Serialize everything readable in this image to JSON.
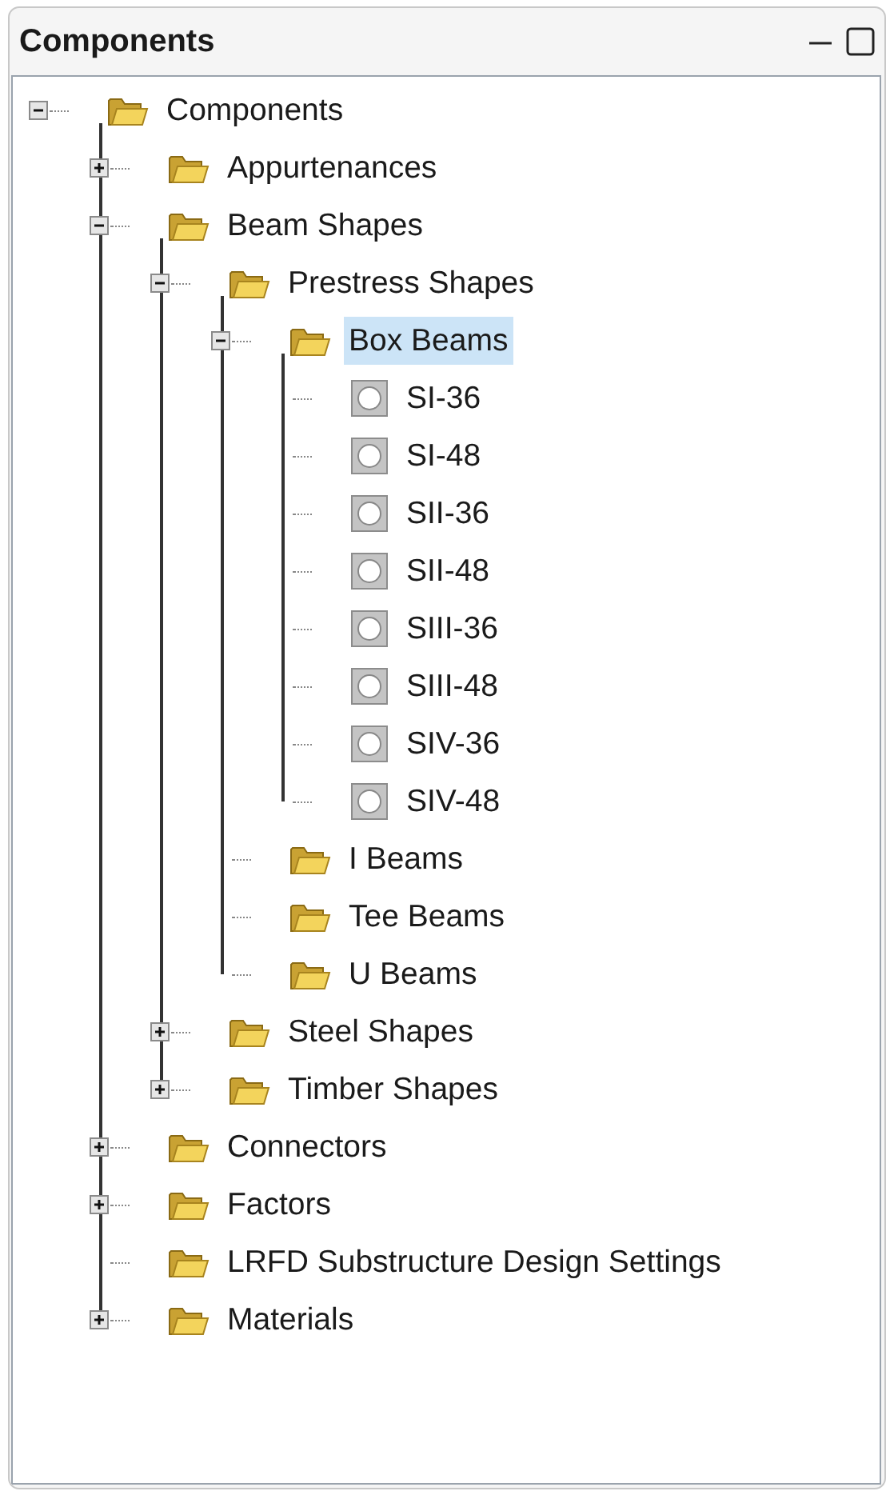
{
  "panel": {
    "title": "Components"
  },
  "tree": [
    {
      "label": "Components",
      "kind": "folder",
      "selected": false,
      "expanded": true,
      "children": [
        {
          "label": "Appurtenances",
          "kind": "folder",
          "selected": false,
          "expanded": false
        },
        {
          "label": "Beam Shapes",
          "kind": "folder",
          "selected": false,
          "expanded": true,
          "children": [
            {
              "label": "Prestress Shapes",
              "kind": "folder",
              "selected": false,
              "expanded": true,
              "children": [
                {
                  "label": "Box Beams",
                  "kind": "folder",
                  "selected": true,
                  "expanded": true,
                  "children": [
                    {
                      "label": "SI-36",
                      "kind": "shape",
                      "selected": false
                    },
                    {
                      "label": "SI-48",
                      "kind": "shape",
                      "selected": false
                    },
                    {
                      "label": "SII-36",
                      "kind": "shape",
                      "selected": false
                    },
                    {
                      "label": "SII-48",
                      "kind": "shape",
                      "selected": false
                    },
                    {
                      "label": "SIII-36",
                      "kind": "shape",
                      "selected": false
                    },
                    {
                      "label": "SIII-48",
                      "kind": "shape",
                      "selected": false
                    },
                    {
                      "label": "SIV-36",
                      "kind": "shape",
                      "selected": false
                    },
                    {
                      "label": "SIV-48",
                      "kind": "shape",
                      "selected": false
                    }
                  ]
                },
                {
                  "label": "I Beams",
                  "kind": "folder",
                  "selected": false
                },
                {
                  "label": "Tee Beams",
                  "kind": "folder",
                  "selected": false
                },
                {
                  "label": "U Beams",
                  "kind": "folder",
                  "selected": false
                }
              ]
            },
            {
              "label": "Steel Shapes",
              "kind": "folder",
              "selected": false,
              "expanded": false
            },
            {
              "label": "Timber Shapes",
              "kind": "folder",
              "selected": false,
              "expanded": false
            }
          ]
        },
        {
          "label": "Connectors",
          "kind": "folder",
          "selected": false,
          "expanded": false
        },
        {
          "label": "Factors",
          "kind": "folder",
          "selected": false,
          "expanded": false
        },
        {
          "label": "LRFD Substructure Design Settings",
          "kind": "folder",
          "selected": false
        },
        {
          "label": "Materials",
          "kind": "folder",
          "selected": false,
          "expanded": false
        }
      ]
    }
  ]
}
